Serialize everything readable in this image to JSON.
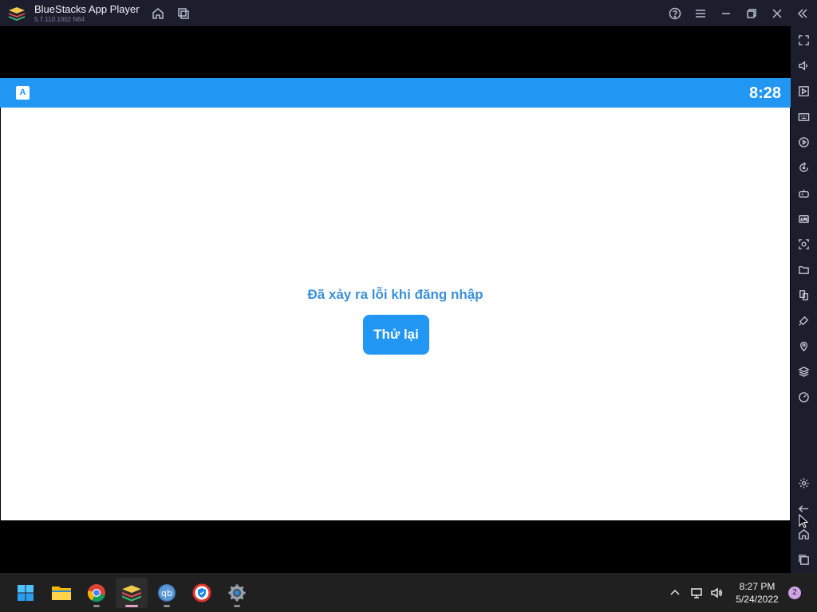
{
  "window": {
    "title": "BlueStacks App Player",
    "version": "5.7.110.1002  N64"
  },
  "android": {
    "status_time": "8:28",
    "status_icon_letter": "A",
    "error_message": "Đã xảy ra lỗi khi đăng nhập",
    "retry_label": "Thử lại"
  },
  "sidebar": {
    "items": [
      "fullscreen-icon",
      "volume-icon",
      "media-icon",
      "keyboard-icon",
      "macro-icon",
      "rotate-sync-icon",
      "gamepad-icon",
      "apk-icon",
      "screenshot-icon",
      "folder-icon",
      "multi-instance-icon",
      "eco-mode-icon",
      "location-icon",
      "layers-icon",
      "performance-icon",
      "settings-icon",
      "back-icon",
      "home-icon",
      "recent-apps-icon"
    ]
  },
  "taskbar": {
    "apps": [
      "windows-start",
      "file-explorer",
      "chrome",
      "bluestacks",
      "qbittorrent",
      "vpn-shield",
      "settings"
    ],
    "clock_time": "8:27 PM",
    "clock_date": "5/24/2022",
    "notification_count": "2"
  },
  "colors": {
    "accent": "#2196f3",
    "titlebar": "#1c1e2e",
    "taskbar": "#202020",
    "error_text": "#3a8fd9"
  }
}
